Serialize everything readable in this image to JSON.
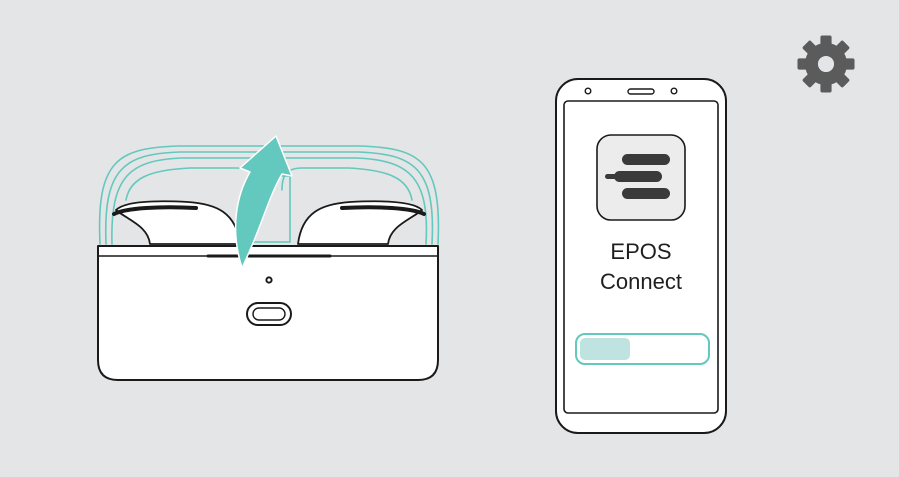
{
  "app": {
    "name_line1": "EPOS",
    "name_line2": "Connect",
    "icon": "epos-logo-icon"
  },
  "progress": {
    "fraction": 0.4
  },
  "colors": {
    "background": "#e4e5e7",
    "accent": "#63c8bd",
    "progress_fill": "#bfe3e0",
    "gear": "#5b5b5b",
    "outline": "#1a1a1a"
  },
  "icons": {
    "settings": "gear-icon",
    "open_lid_arrow": "open-lid-arrow-icon"
  }
}
